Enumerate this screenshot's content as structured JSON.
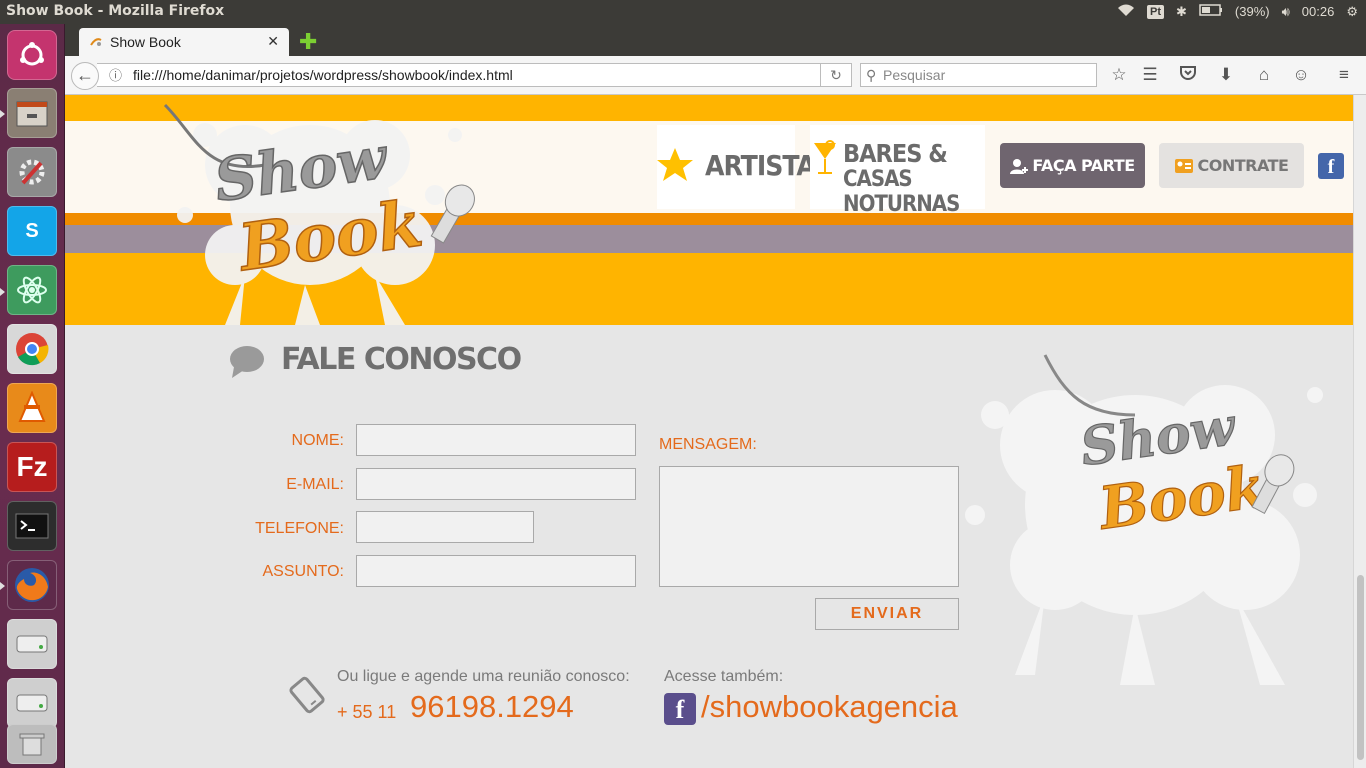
{
  "panel": {
    "window_title": "Show Book - Mozilla Firefox",
    "keyboard": "Pt",
    "battery": "(39%)",
    "time": "00:26"
  },
  "launcher": {
    "items": [
      "ubuntu-dash",
      "files",
      "system-settings",
      "skype",
      "atom",
      "chrome",
      "vlc",
      "filezilla",
      "terminal",
      "firefox",
      "disk",
      "disk",
      "trash"
    ]
  },
  "browser": {
    "tab_title": "Show Book",
    "url": "file:///home/danimar/projetos/wordpress/showbook/index.html",
    "search_placeholder": "Pesquisar"
  },
  "site": {
    "logo_top": "Show",
    "logo_bottom": "Book",
    "nav": {
      "artistas": "ARTISTAS",
      "bares_line1": "BARES &",
      "bares_line2": "CASAS NOTURNAS",
      "faca_parte": "FAÇA PARTE",
      "contrate": "CONTRATE"
    },
    "contact": {
      "title": "FALE CONOSCO",
      "labels": {
        "nome": "NOME:",
        "email": "E-MAIL:",
        "telefone": "TELEFONE:",
        "assunto": "ASSUNTO:",
        "mensagem": "MENSAGEM:"
      },
      "send_label": "ENVIAR",
      "call_text": "Ou ligue e agende uma reunião conosco:",
      "phone_prefix": "+ 55 11",
      "phone_number": "96198.1294",
      "also_text": "Acesse também:",
      "facebook_handle": "/showbookagencia"
    },
    "colors": {
      "yellow": "#ffb400",
      "orange": "#f08c00",
      "accent_text": "#e46a1c",
      "purple_grey": "#9c8e9c"
    }
  }
}
